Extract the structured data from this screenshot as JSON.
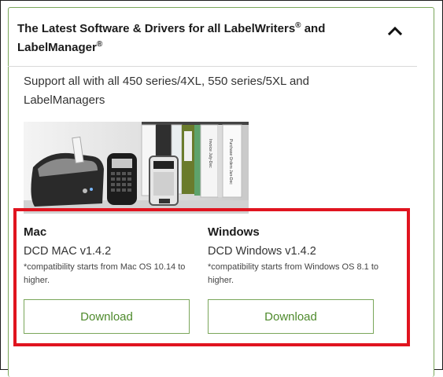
{
  "section": {
    "title_line1": "The Latest Software & Drivers for all LabelWriters",
    "title_mark1": "®",
    "title_and": " and",
    "title_line2": "LabelManager",
    "title_mark2": "®",
    "support_text": "Support all with all 450 series/4XL, 550 series/5XL and LabelManagers",
    "collapse_icon": "chevron-up-icon"
  },
  "image": {
    "description_icon": "label-printers-photo",
    "binder_spine_text_1": "Purchase Orders Jan-Dec",
    "binder_spine_text_2": "Invoice July-Dec"
  },
  "downloads": [
    {
      "os": "Mac",
      "version": "DCD MAC v1.4.2",
      "compat": "*compatibility starts from Mac OS 10.14 to higher.",
      "button": "Download"
    },
    {
      "os": "Windows",
      "version": "DCD Windows v1.4.2",
      "compat": "*compatibility starts from Windows OS 8.1 to higher.",
      "button": "Download"
    }
  ],
  "colors": {
    "accent_green": "#4e8a2c",
    "border_green": "#7aa65a",
    "highlight_red": "#e0141f"
  }
}
